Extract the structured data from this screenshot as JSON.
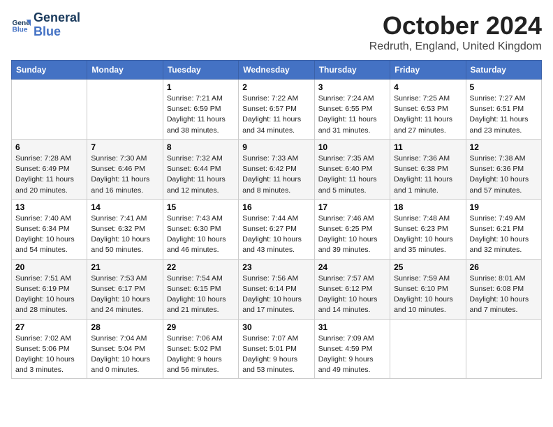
{
  "header": {
    "logo_line1": "General",
    "logo_line2": "Blue",
    "month": "October 2024",
    "location": "Redruth, England, United Kingdom"
  },
  "weekdays": [
    "Sunday",
    "Monday",
    "Tuesday",
    "Wednesday",
    "Thursday",
    "Friday",
    "Saturday"
  ],
  "weeks": [
    [
      {
        "day": "",
        "sunrise": "",
        "sunset": "",
        "daylight": ""
      },
      {
        "day": "",
        "sunrise": "",
        "sunset": "",
        "daylight": ""
      },
      {
        "day": "1",
        "sunrise": "Sunrise: 7:21 AM",
        "sunset": "Sunset: 6:59 PM",
        "daylight": "Daylight: 11 hours and 38 minutes."
      },
      {
        "day": "2",
        "sunrise": "Sunrise: 7:22 AM",
        "sunset": "Sunset: 6:57 PM",
        "daylight": "Daylight: 11 hours and 34 minutes."
      },
      {
        "day": "3",
        "sunrise": "Sunrise: 7:24 AM",
        "sunset": "Sunset: 6:55 PM",
        "daylight": "Daylight: 11 hours and 31 minutes."
      },
      {
        "day": "4",
        "sunrise": "Sunrise: 7:25 AM",
        "sunset": "Sunset: 6:53 PM",
        "daylight": "Daylight: 11 hours and 27 minutes."
      },
      {
        "day": "5",
        "sunrise": "Sunrise: 7:27 AM",
        "sunset": "Sunset: 6:51 PM",
        "daylight": "Daylight: 11 hours and 23 minutes."
      }
    ],
    [
      {
        "day": "6",
        "sunrise": "Sunrise: 7:28 AM",
        "sunset": "Sunset: 6:49 PM",
        "daylight": "Daylight: 11 hours and 20 minutes."
      },
      {
        "day": "7",
        "sunrise": "Sunrise: 7:30 AM",
        "sunset": "Sunset: 6:46 PM",
        "daylight": "Daylight: 11 hours and 16 minutes."
      },
      {
        "day": "8",
        "sunrise": "Sunrise: 7:32 AM",
        "sunset": "Sunset: 6:44 PM",
        "daylight": "Daylight: 11 hours and 12 minutes."
      },
      {
        "day": "9",
        "sunrise": "Sunrise: 7:33 AM",
        "sunset": "Sunset: 6:42 PM",
        "daylight": "Daylight: 11 hours and 8 minutes."
      },
      {
        "day": "10",
        "sunrise": "Sunrise: 7:35 AM",
        "sunset": "Sunset: 6:40 PM",
        "daylight": "Daylight: 11 hours and 5 minutes."
      },
      {
        "day": "11",
        "sunrise": "Sunrise: 7:36 AM",
        "sunset": "Sunset: 6:38 PM",
        "daylight": "Daylight: 11 hours and 1 minute."
      },
      {
        "day": "12",
        "sunrise": "Sunrise: 7:38 AM",
        "sunset": "Sunset: 6:36 PM",
        "daylight": "Daylight: 10 hours and 57 minutes."
      }
    ],
    [
      {
        "day": "13",
        "sunrise": "Sunrise: 7:40 AM",
        "sunset": "Sunset: 6:34 PM",
        "daylight": "Daylight: 10 hours and 54 minutes."
      },
      {
        "day": "14",
        "sunrise": "Sunrise: 7:41 AM",
        "sunset": "Sunset: 6:32 PM",
        "daylight": "Daylight: 10 hours and 50 minutes."
      },
      {
        "day": "15",
        "sunrise": "Sunrise: 7:43 AM",
        "sunset": "Sunset: 6:30 PM",
        "daylight": "Daylight: 10 hours and 46 minutes."
      },
      {
        "day": "16",
        "sunrise": "Sunrise: 7:44 AM",
        "sunset": "Sunset: 6:27 PM",
        "daylight": "Daylight: 10 hours and 43 minutes."
      },
      {
        "day": "17",
        "sunrise": "Sunrise: 7:46 AM",
        "sunset": "Sunset: 6:25 PM",
        "daylight": "Daylight: 10 hours and 39 minutes."
      },
      {
        "day": "18",
        "sunrise": "Sunrise: 7:48 AM",
        "sunset": "Sunset: 6:23 PM",
        "daylight": "Daylight: 10 hours and 35 minutes."
      },
      {
        "day": "19",
        "sunrise": "Sunrise: 7:49 AM",
        "sunset": "Sunset: 6:21 PM",
        "daylight": "Daylight: 10 hours and 32 minutes."
      }
    ],
    [
      {
        "day": "20",
        "sunrise": "Sunrise: 7:51 AM",
        "sunset": "Sunset: 6:19 PM",
        "daylight": "Daylight: 10 hours and 28 minutes."
      },
      {
        "day": "21",
        "sunrise": "Sunrise: 7:53 AM",
        "sunset": "Sunset: 6:17 PM",
        "daylight": "Daylight: 10 hours and 24 minutes."
      },
      {
        "day": "22",
        "sunrise": "Sunrise: 7:54 AM",
        "sunset": "Sunset: 6:15 PM",
        "daylight": "Daylight: 10 hours and 21 minutes."
      },
      {
        "day": "23",
        "sunrise": "Sunrise: 7:56 AM",
        "sunset": "Sunset: 6:14 PM",
        "daylight": "Daylight: 10 hours and 17 minutes."
      },
      {
        "day": "24",
        "sunrise": "Sunrise: 7:57 AM",
        "sunset": "Sunset: 6:12 PM",
        "daylight": "Daylight: 10 hours and 14 minutes."
      },
      {
        "day": "25",
        "sunrise": "Sunrise: 7:59 AM",
        "sunset": "Sunset: 6:10 PM",
        "daylight": "Daylight: 10 hours and 10 minutes."
      },
      {
        "day": "26",
        "sunrise": "Sunrise: 8:01 AM",
        "sunset": "Sunset: 6:08 PM",
        "daylight": "Daylight: 10 hours and 7 minutes."
      }
    ],
    [
      {
        "day": "27",
        "sunrise": "Sunrise: 7:02 AM",
        "sunset": "Sunset: 5:06 PM",
        "daylight": "Daylight: 10 hours and 3 minutes."
      },
      {
        "day": "28",
        "sunrise": "Sunrise: 7:04 AM",
        "sunset": "Sunset: 5:04 PM",
        "daylight": "Daylight: 10 hours and 0 minutes."
      },
      {
        "day": "29",
        "sunrise": "Sunrise: 7:06 AM",
        "sunset": "Sunset: 5:02 PM",
        "daylight": "Daylight: 9 hours and 56 minutes."
      },
      {
        "day": "30",
        "sunrise": "Sunrise: 7:07 AM",
        "sunset": "Sunset: 5:01 PM",
        "daylight": "Daylight: 9 hours and 53 minutes."
      },
      {
        "day": "31",
        "sunrise": "Sunrise: 7:09 AM",
        "sunset": "Sunset: 4:59 PM",
        "daylight": "Daylight: 9 hours and 49 minutes."
      },
      {
        "day": "",
        "sunrise": "",
        "sunset": "",
        "daylight": ""
      },
      {
        "day": "",
        "sunrise": "",
        "sunset": "",
        "daylight": ""
      }
    ]
  ]
}
